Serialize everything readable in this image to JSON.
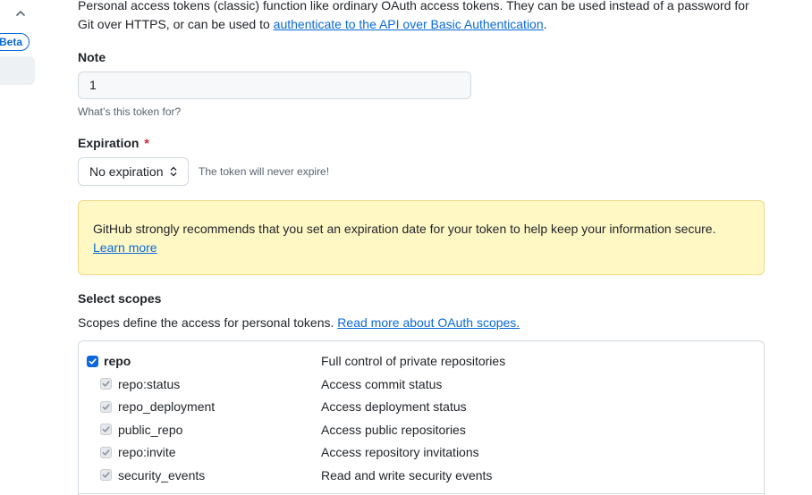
{
  "intro": {
    "text": "Personal access tokens (classic) function like ordinary OAuth access tokens. They can be used instead of a password for Git over HTTPS, or can be used to ",
    "link": "authenticate to the API over Basic Authentication",
    "suffix": "."
  },
  "sidebar": {
    "badge": "Beta"
  },
  "note": {
    "label": "Note",
    "value": "1",
    "hint": "What’s this token for?"
  },
  "expiration": {
    "label": "Expiration",
    "required_mark": "*",
    "selected": "No expiration",
    "note": "The token will never expire!"
  },
  "flash": {
    "text": "GitHub strongly recommends that you set an expiration date for your token to help keep your information secure.",
    "link": "Learn more"
  },
  "scopes": {
    "title": "Select scopes",
    "description": "Scopes define the access for personal tokens.",
    "link": "Read more about OAuth scopes.",
    "items": [
      {
        "name": "repo",
        "description": "Full control of private repositories",
        "parent": true,
        "checked": true
      },
      {
        "name": "repo:status",
        "description": "Access commit status",
        "parent": false,
        "checked": true
      },
      {
        "name": "repo_deployment",
        "description": "Access deployment status",
        "parent": false,
        "checked": true
      },
      {
        "name": "public_repo",
        "description": "Access public repositories",
        "parent": false,
        "checked": true
      },
      {
        "name": "repo:invite",
        "description": "Access repository invitations",
        "parent": false,
        "checked": true
      },
      {
        "name": "security_events",
        "description": "Read and write security events",
        "parent": false,
        "checked": true
      }
    ]
  },
  "colors": {
    "link": "#0969da",
    "flash_bg": "#fff8c5",
    "required": "#d1242f"
  }
}
